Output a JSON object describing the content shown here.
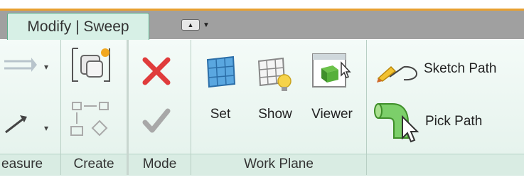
{
  "tab": {
    "label": "Modify | Sweep"
  },
  "panels": {
    "measure": {
      "label": "easure"
    },
    "create": {
      "label": "Create"
    },
    "mode": {
      "label": "Mode"
    },
    "work_plane": {
      "label": "Work Plane"
    }
  },
  "buttons": {
    "set": "Set",
    "show": "Show",
    "viewer": "Viewer",
    "sketch_path": "Sketch Path",
    "pick_path": "Pick Path"
  },
  "colors": {
    "accent": "#e8a030",
    "tab_bg": "#d7f0e6",
    "ribbon_bg": "#eef8f3",
    "cancel": "#e03c3c",
    "finish_gray": "#9a9a9a"
  }
}
